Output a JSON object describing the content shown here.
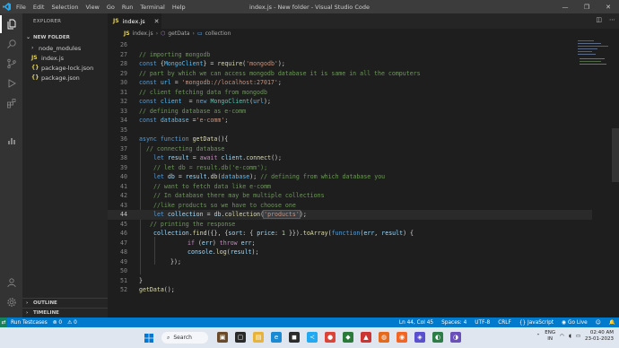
{
  "window": {
    "menu": [
      "File",
      "Edit",
      "Selection",
      "View",
      "Go",
      "Run",
      "Terminal",
      "Help"
    ],
    "title": "index.js - New folder - Visual Studio Code",
    "controls": [
      "—",
      "❐",
      "✕"
    ]
  },
  "sidebar": {
    "title": "EXPLORER",
    "folder": "NEW FOLDER",
    "items": [
      {
        "label": "node_modules",
        "icon": "chevron-right-icon",
        "type": "folder"
      },
      {
        "label": "index.js",
        "icon": "js-icon",
        "badge": "JS",
        "type": "file"
      },
      {
        "label": "package-lock.json",
        "icon": "json-icon",
        "badge": "{}",
        "type": "file"
      },
      {
        "label": "package.json",
        "icon": "json-icon",
        "badge": "{}",
        "type": "file"
      }
    ],
    "outline": "OUTLINE",
    "timeline": "TIMELINE"
  },
  "activity_bar": [
    "files-icon",
    "search-icon",
    "source-control-icon",
    "run-debug-icon",
    "extensions-icon",
    "charts-icon",
    "account-icon",
    "settings-gear-icon"
  ],
  "tab": {
    "badge": "JS",
    "label": "index.js",
    "close": "✕"
  },
  "breadcrumb": {
    "file_badge": "JS",
    "file": "index.js",
    "func": "getData",
    "var": "collection"
  },
  "code_lines": [
    {
      "n": "26"
    },
    {
      "n": "27"
    },
    {
      "n": "28"
    },
    {
      "n": "29"
    },
    {
      "n": "30"
    },
    {
      "n": "31"
    },
    {
      "n": "32"
    },
    {
      "n": "33"
    },
    {
      "n": "34"
    },
    {
      "n": "35"
    },
    {
      "n": "36"
    },
    {
      "n": "37"
    },
    {
      "n": "38"
    },
    {
      "n": "39"
    },
    {
      "n": "40"
    },
    {
      "n": "41"
    },
    {
      "n": "42"
    },
    {
      "n": "43"
    },
    {
      "n": "44"
    },
    {
      "n": "45"
    },
    {
      "n": "46"
    },
    {
      "n": "47"
    },
    {
      "n": "48"
    },
    {
      "n": "49"
    },
    {
      "n": "50"
    },
    {
      "n": "51"
    },
    {
      "n": "52"
    }
  ],
  "code": {
    "l27": "// importing mongodb",
    "l28a": "const",
    "l28b": " {",
    "l28c": "MongoClient",
    "l28d": "} = ",
    "l28e": "require",
    "l28f": "(",
    "l28g": "'mongodb'",
    "l28h": ");",
    "l29": "// part by which we can access mongodb database it is same in all the computers",
    "l30a": "const",
    "l30b": " url",
    "l30c": " = ",
    "l30d": "'mongodb://localhost:27017'",
    "l30e": ";",
    "l31": "// client fetching data from mongodb",
    "l32a": "const",
    "l32b": " client",
    "l32c": "  = ",
    "l32d": "new",
    "l32e": " MongoClient",
    "l32f": "(",
    "l32g": "url",
    "l32h": ");",
    "l33": "// defining database as e-comm",
    "l34a": "const",
    "l34b": " database",
    "l34c": " =",
    "l34d": "'e-comm'",
    "l34e": ";",
    "l36a": "async",
    "l36b": " function",
    "l36c": " getData",
    "l36d": "(){",
    "l37": "// connecting database",
    "l38a": "let",
    "l38b": " result",
    "l38c": " = ",
    "l38d": "await",
    "l38e": " client",
    "l38f": ".",
    "l38g": "connect",
    "l38h": "();",
    "l39": "// let db = result.db('e-comm');",
    "l40a": "let",
    "l40b": " db",
    "l40c": " = ",
    "l40d": "result",
    "l40e": ".",
    "l40f": "db",
    "l40g": "(",
    "l40h": "database",
    "l40i": "); ",
    "l40j": "// defining from which database you",
    "l41": "// want to fetch data like e-comm",
    "l42": "// In database there may be multiple collections",
    "l43": "//like products so we have to choose one",
    "l44a": "let",
    "l44b": " collection",
    "l44c": " = ",
    "l44d": "db",
    "l44e": ".",
    "l44f": "collection",
    "l44g": "(",
    "l44h": "'products'",
    "l44i": ");",
    "l45": "// printing the response",
    "l46a": "collection",
    "l46b": ".",
    "l46c": "find",
    "l46d": "({}, {",
    "l46e": "sort",
    "l46f": ": { ",
    "l46g": "price",
    "l46h": ": ",
    "l46i": "1",
    "l46j": " }}).",
    "l46k": "toArray",
    "l46l": "(",
    "l46m": "function",
    "l46n": "(",
    "l46o": "err",
    "l46p": ", ",
    "l46q": "result",
    "l46r": ") {",
    "l47a": "if",
    "l47b": " (",
    "l47c": "err",
    "l47d": ") ",
    "l47e": "throw",
    "l47f": " err",
    "l47g": ";",
    "l48a": "console",
    "l48b": ".",
    "l48c": "log",
    "l48d": "(",
    "l48e": "result",
    "l48f": ");",
    "l49": "});",
    "l51": "}",
    "l52a": "getData",
    "l52b": "();"
  },
  "status": {
    "run": "Run Testcases",
    "errors": "⊗ 0",
    "warnings": "⚠ 0",
    "position": "Ln 44, Col 45",
    "spaces": "Spaces: 4",
    "encoding": "UTF-8",
    "eol": "CRLF",
    "language": "{} JavaScript",
    "golive": "Go Live",
    "bell": "🔔"
  },
  "taskbar": {
    "search": "Search",
    "lang1": "ENG",
    "lang2": "IN",
    "time": "02:40 AM",
    "date": "23-01-2023"
  }
}
